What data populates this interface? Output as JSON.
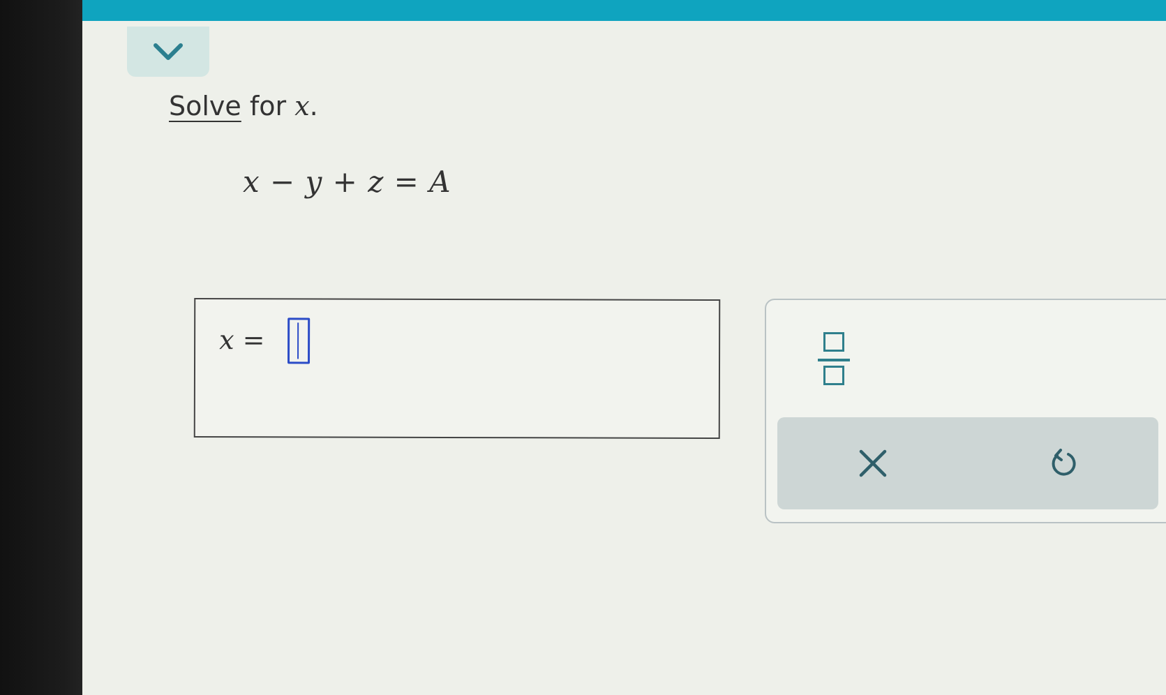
{
  "prompt": {
    "link_text": "Solve",
    "middle_text": " for ",
    "variable": "x",
    "end_text": "."
  },
  "equation": {
    "text": "x − y + z = A"
  },
  "answer": {
    "lhs_variable": "x",
    "equals": " = ",
    "value": ""
  },
  "tools": {
    "fraction_icon": "fraction-icon",
    "clear_icon": "close-icon",
    "undo_icon": "undo-icon"
  },
  "colors": {
    "top_bar": "#0fa4bf",
    "accent": "#2f7f8c",
    "input_cursor": "#2b4bc7"
  }
}
